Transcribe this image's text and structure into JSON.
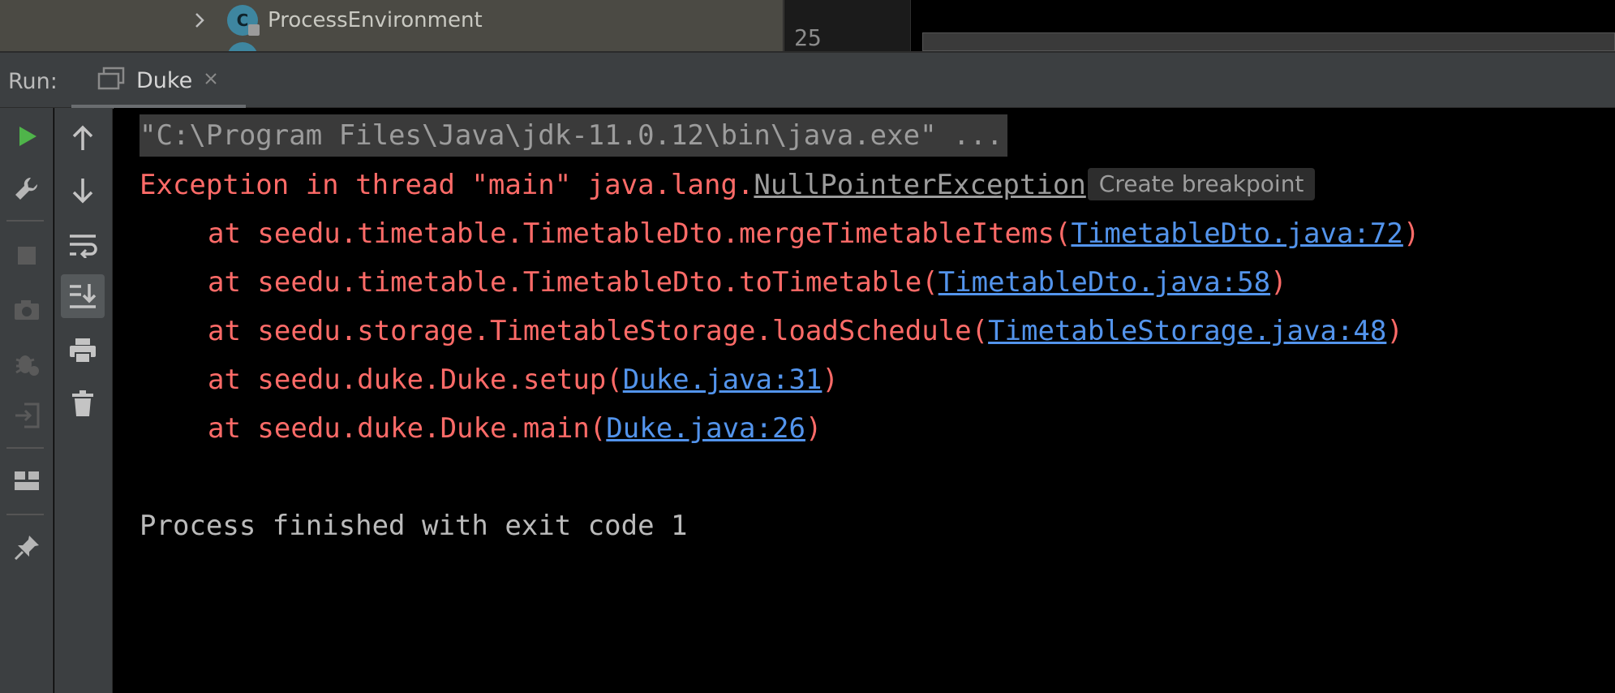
{
  "project_tree": {
    "visible_item": {
      "label": "ProcessEnvironment",
      "icon_letter": "C"
    }
  },
  "editor": {
    "line_number": "25"
  },
  "run_panel": {
    "title": "Run:",
    "tab": {
      "label": "Duke"
    }
  },
  "console": {
    "command_line": "\"C:\\Program Files\\Java\\jdk-11.0.12\\bin\\java.exe\" ...",
    "exception": {
      "prefix": "Exception in thread \"main\" java.lang.",
      "class_link": "NullPointerException",
      "breakpoint_hint": "Create breakpoint"
    },
    "stack_trace": [
      {
        "prefix": "at seedu.timetable.TimetableDto.mergeTimetableItems(",
        "link": "TimetableDto.java:72",
        "suffix": ")"
      },
      {
        "prefix": "at seedu.timetable.TimetableDto.toTimetable(",
        "link": "TimetableDto.java:58",
        "suffix": ")"
      },
      {
        "prefix": "at seedu.storage.TimetableStorage.loadSchedule(",
        "link": "TimetableStorage.java:48",
        "suffix": ")"
      },
      {
        "prefix": "at seedu.duke.Duke.setup(",
        "link": "Duke.java:31",
        "suffix": ")"
      },
      {
        "prefix": "at seedu.duke.Duke.main(",
        "link": "Duke.java:26",
        "suffix": ")"
      }
    ],
    "exit_message": "Process finished with exit code 1"
  },
  "colors": {
    "error_text": "#ff6b68",
    "link": "#5394ec",
    "run_green": "#4fb44a",
    "panel_bg": "#3c3f41",
    "console_bg": "#000000"
  },
  "icons": {
    "left_toolbar": [
      "play-icon",
      "wrench-icon",
      "stop-icon",
      "camera-icon",
      "debug-bug-icon",
      "login-arrow-icon",
      "layout-icon",
      "pin-icon"
    ],
    "second_toolbar": [
      "arrow-up-icon",
      "arrow-down-icon",
      "soft-wrap-icon",
      "scroll-to-end-icon",
      "print-icon",
      "trash-icon"
    ]
  }
}
